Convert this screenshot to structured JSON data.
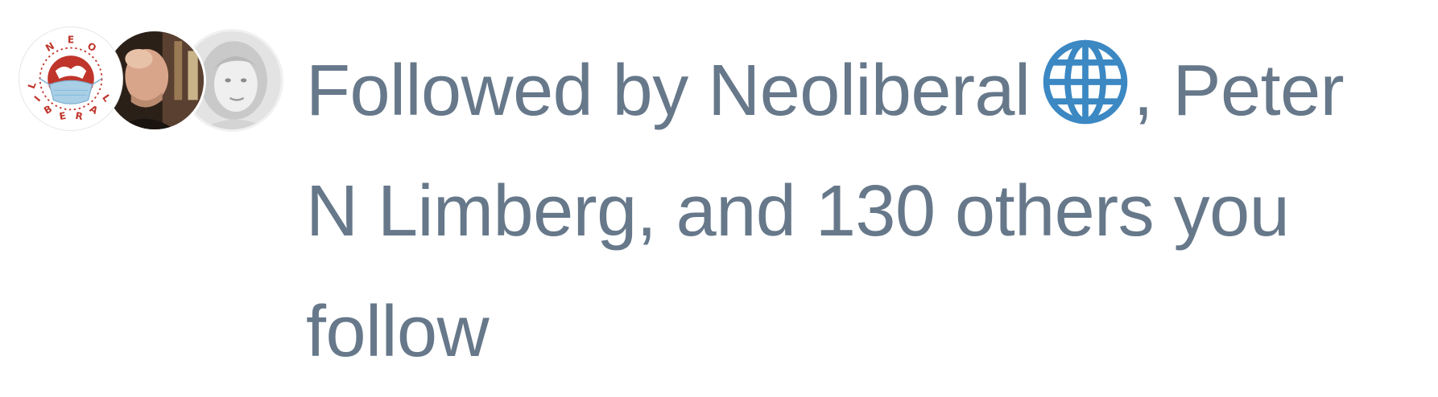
{
  "followed_by": {
    "avatars": [
      {
        "name": "Neoliberal",
        "image": "neoliberal-logo",
        "logo_text": "NEO LIBERAL"
      },
      {
        "name": "Peter N Limberg",
        "image": "man-portrait-photo"
      },
      {
        "name": "",
        "image": "woman-portrait-photo"
      }
    ],
    "text": {
      "prefix": "Followed by ",
      "first_name": "Neoliberal",
      "first_name_icon": "globe-icon",
      "separator": ", ",
      "second_name_part1": "Peter",
      "second_name_part2": "N Limberg",
      "conjunction": ", and ",
      "others_count": "130",
      "others_suffix": " others you",
      "trailing": "follow"
    },
    "colors": {
      "text": "#66788a",
      "globe": "#3b88c3",
      "logo_red": "#c0352b",
      "mask_blue": "#a9cfe6"
    }
  }
}
